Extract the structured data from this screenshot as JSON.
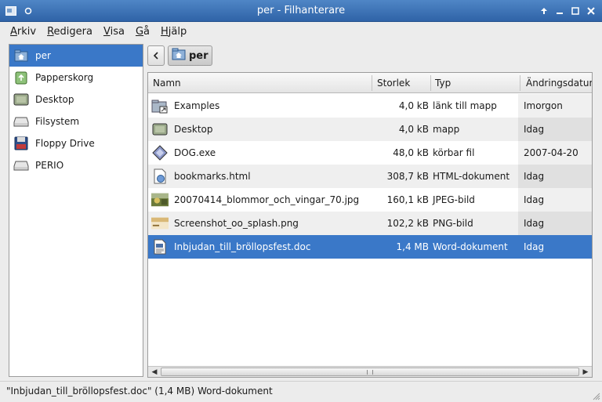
{
  "window": {
    "title": "per - Filhanterare"
  },
  "menu": [
    "Arkiv",
    "Redigera",
    "Visa",
    "Gå",
    "Hjälp"
  ],
  "menu_underline": [
    "A",
    "R",
    "V",
    "G",
    "H"
  ],
  "sidebar": {
    "items": [
      {
        "label": "per",
        "icon": "home-folder-icon",
        "selected": true
      },
      {
        "label": "Papperskorg",
        "icon": "trash-icon",
        "selected": false
      },
      {
        "label": "Desktop",
        "icon": "desktop-icon",
        "selected": false
      },
      {
        "label": "Filsystem",
        "icon": "drive-icon",
        "selected": false
      },
      {
        "label": "Floppy Drive",
        "icon": "floppy-icon",
        "selected": false
      },
      {
        "label": "PERIO",
        "icon": "drive-icon",
        "selected": false
      }
    ]
  },
  "pathbar": {
    "current": "per"
  },
  "columns": {
    "name": "Namn",
    "size": "Storlek",
    "type": "Typ",
    "modified": "Ändringsdatum"
  },
  "files": [
    {
      "name": "Examples",
      "size": "4,0 kB",
      "type": "länk till mapp",
      "modified": "Imorgon",
      "icon": "folder-link-icon"
    },
    {
      "name": "Desktop",
      "size": "4,0 kB",
      "type": "mapp",
      "modified": "Idag",
      "icon": "desktop-folder-icon"
    },
    {
      "name": "DOG.exe",
      "size": "48,0 kB",
      "type": "körbar fil",
      "modified": "2007-04-20",
      "icon": "executable-icon"
    },
    {
      "name": "bookmarks.html",
      "size": "308,7 kB",
      "type": "HTML-dokument",
      "modified": "Idag",
      "icon": "html-icon"
    },
    {
      "name": "20070414_blommor_och_vingar_70.jpg",
      "size": "160,1 kB",
      "type": "JPEG-bild",
      "modified": "Idag",
      "icon": "jpeg-thumbnail-icon"
    },
    {
      "name": "Screenshot_oo_splash.png",
      "size": "102,2 kB",
      "type": "PNG-bild",
      "modified": "Idag",
      "icon": "png-thumbnail-icon"
    },
    {
      "name": "Inbjudan_till_bröllopsfest.doc",
      "size": "1,4 MB",
      "type": "Word-dokument",
      "modified": "Idag",
      "icon": "document-icon",
      "selected": true
    }
  ],
  "status": {
    "text": "\"Inbjudan_till_bröllopsfest.doc\" (1,4 MB) Word-dokument"
  },
  "colors": {
    "selection": "#3a78c8",
    "titlebar": "#3f74b8"
  }
}
